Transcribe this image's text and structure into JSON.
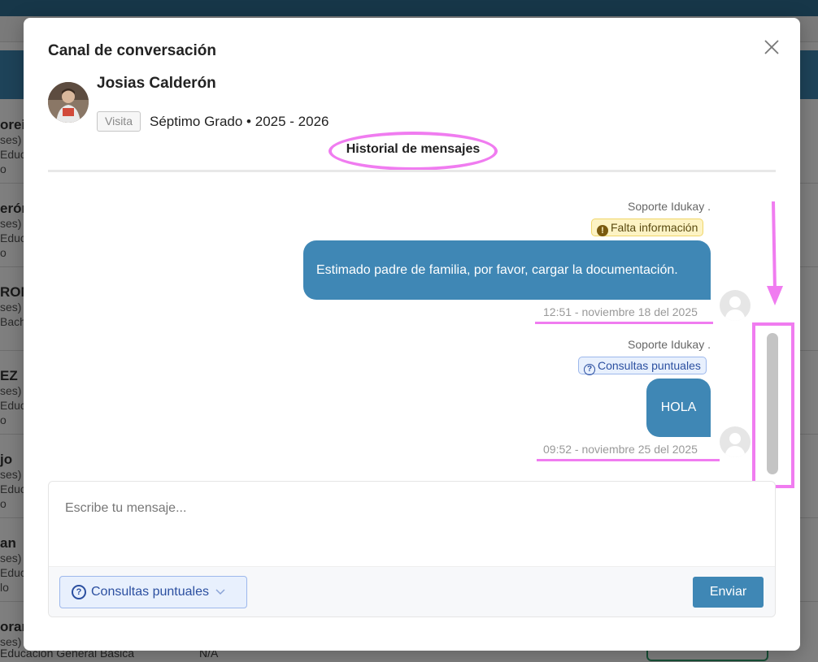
{
  "background": {
    "rows": [
      {
        "name": "oreir",
        "l1": "ses)",
        "l2": "Educ",
        "l3": "o"
      },
      {
        "name": "erón",
        "l1": "ses)",
        "l2": "Educ",
        "l3": "o"
      },
      {
        "name": "RON",
        "l1": "ses)",
        "l2": "Bach",
        "l3": ""
      },
      {
        "name": "EZ",
        "l1": "ses)",
        "l2": "Educ",
        "l3": "o"
      },
      {
        "name": "jo",
        "l1": "ses)",
        "l2": "Educ",
        "l3": "o"
      },
      {
        "name": "an",
        "l1": "ses)",
        "l2": "Educ",
        "l3": "lo"
      },
      {
        "name": "oran",
        "l1": "ses)",
        "l2": "",
        "l3": ""
      }
    ],
    "footer_text": "Educación General Básica",
    "na_text": "N/A"
  },
  "modal": {
    "title": "Canal de conversación",
    "student": {
      "name": "Josias Calderón",
      "badge": "Visita",
      "grade": "Séptimo Grado • 2025 - 2026"
    },
    "tab": "Historial de mensajes",
    "messages": [
      {
        "sender": "Soporte Idukay .",
        "tag": "Falta información",
        "tag_icon": "!",
        "text": "Estimado padre de familia, por favor, cargar la documentación.",
        "time": "12:51 - noviembre 18 del 2025"
      },
      {
        "sender": "Soporte Idukay .",
        "tag": "Consultas puntuales",
        "tag_icon": "?",
        "text": "HOLA",
        "time": "09:52 - noviembre 25 del 2025"
      }
    ],
    "composer": {
      "placeholder": "Escribe tu mensaje...",
      "category": "Consultas puntuales",
      "send": "Enviar"
    }
  },
  "colors": {
    "accent": "#3f87b5",
    "highlight": "#f07cf0",
    "warn_tag_bg": "#fdf3c4",
    "info_tag_bg": "#e8f0fd"
  },
  "icons": {
    "close": "close-icon",
    "warning": "exclamation-circle-icon",
    "question": "question-circle-icon",
    "chevron": "chevron-down-icon"
  }
}
